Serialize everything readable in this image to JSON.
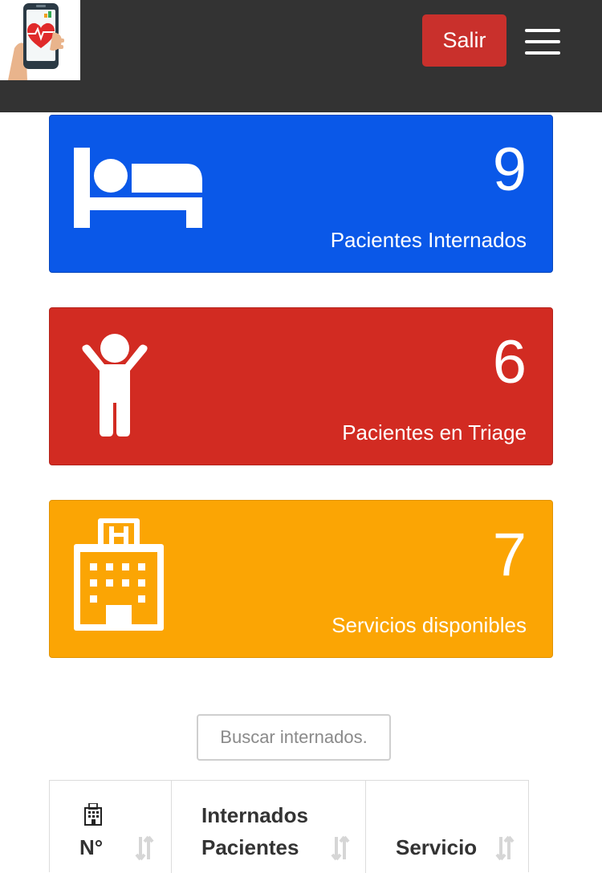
{
  "header": {
    "logout_label": "Salir"
  },
  "cards": [
    {
      "value": "9",
      "label": "Pacientes Internados",
      "color": "#0a58e8",
      "icon": "bed-icon"
    },
    {
      "value": "6",
      "label": "Pacientes en Triage",
      "color": "#d22b22",
      "icon": "person-icon"
    },
    {
      "value": "7",
      "label": "Servicios disponibles",
      "color": "#fba504",
      "icon": "hospital-icon"
    }
  ],
  "search": {
    "placeholder": "Buscar internados."
  },
  "table": {
    "columns": [
      {
        "line1": "",
        "line2": "N°",
        "icon": "hospital-icon"
      },
      {
        "line1": "Internados",
        "line2": "Pacientes"
      },
      {
        "line1": "",
        "line2": "Servicio"
      }
    ]
  }
}
